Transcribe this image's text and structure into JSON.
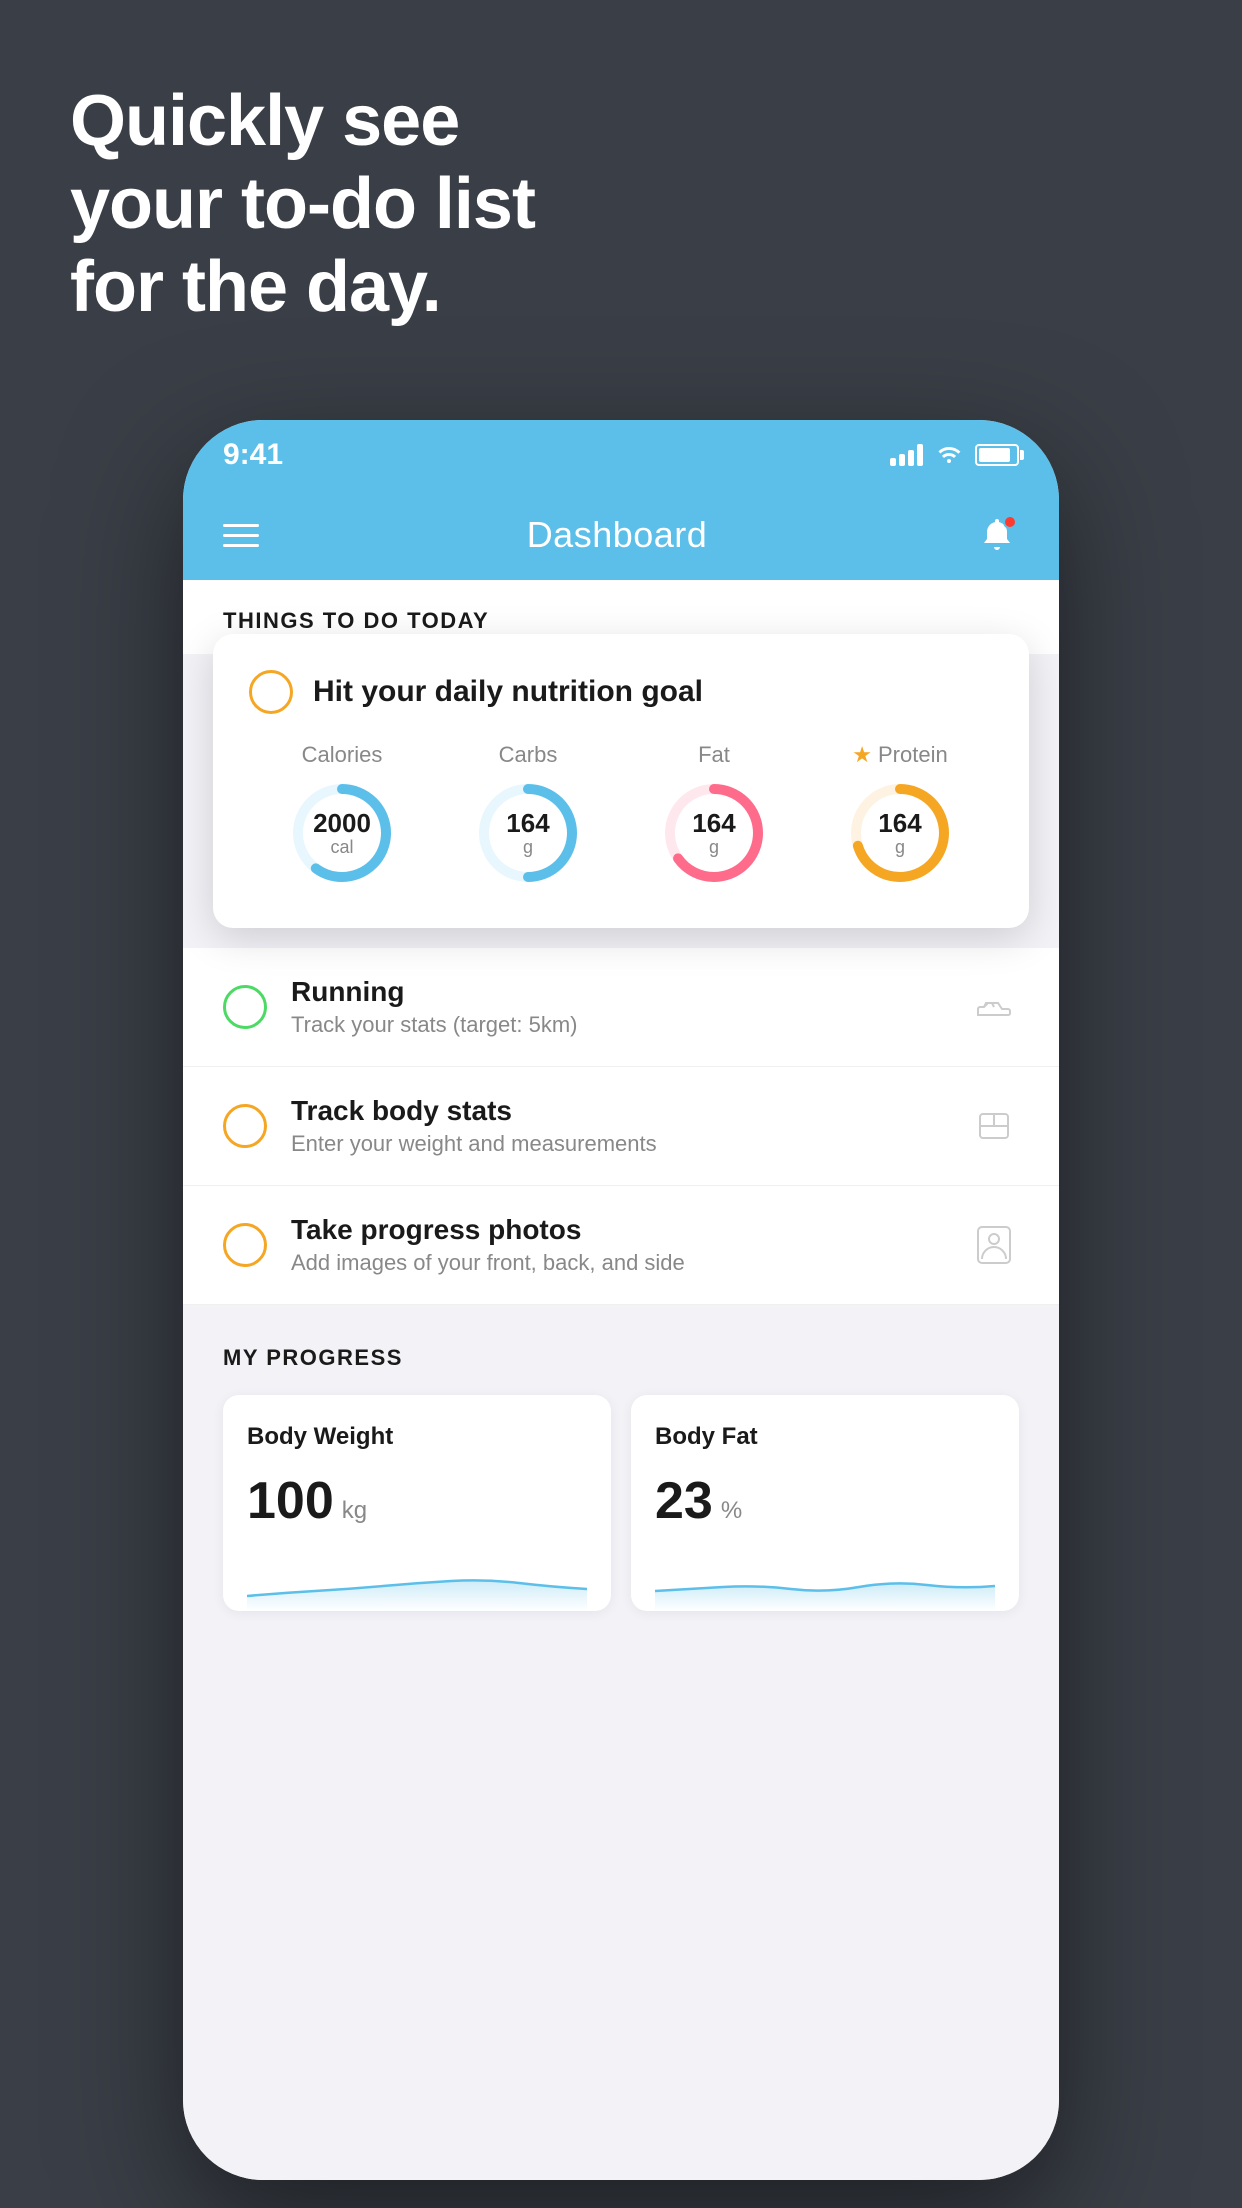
{
  "hero": {
    "line1": "Quickly see",
    "line2": "your to-do list",
    "line3": "for the day."
  },
  "status_bar": {
    "time": "9:41"
  },
  "nav": {
    "title": "Dashboard"
  },
  "things_to_do": {
    "section_label": "THINGS TO DO TODAY"
  },
  "nutrition_card": {
    "title": "Hit your daily nutrition goal",
    "items": [
      {
        "label": "Calories",
        "value": "2000",
        "unit": "cal",
        "color": "#5bbfea",
        "bg_color": "#e8f7fd",
        "percent": 60
      },
      {
        "label": "Carbs",
        "value": "164",
        "unit": "g",
        "color": "#5bbfea",
        "bg_color": "#e8f7fd",
        "percent": 50
      },
      {
        "label": "Fat",
        "value": "164",
        "unit": "g",
        "color": "#ff6b8a",
        "bg_color": "#ffe8ed",
        "percent": 65
      },
      {
        "label": "Protein",
        "value": "164",
        "unit": "g",
        "color": "#f5a623",
        "bg_color": "#fef3e2",
        "percent": 70,
        "star": true
      }
    ]
  },
  "todo_items": [
    {
      "title": "Running",
      "subtitle": "Track your stats (target: 5km)",
      "circle_color": "green",
      "icon": "shoe"
    },
    {
      "title": "Track body stats",
      "subtitle": "Enter your weight and measurements",
      "circle_color": "yellow",
      "icon": "scale"
    },
    {
      "title": "Take progress photos",
      "subtitle": "Add images of your front, back, and side",
      "circle_color": "yellow",
      "icon": "person"
    }
  ],
  "progress": {
    "section_label": "MY PROGRESS",
    "cards": [
      {
        "title": "Body Weight",
        "value": "100",
        "unit": "kg"
      },
      {
        "title": "Body Fat",
        "value": "23",
        "unit": "%"
      }
    ]
  }
}
